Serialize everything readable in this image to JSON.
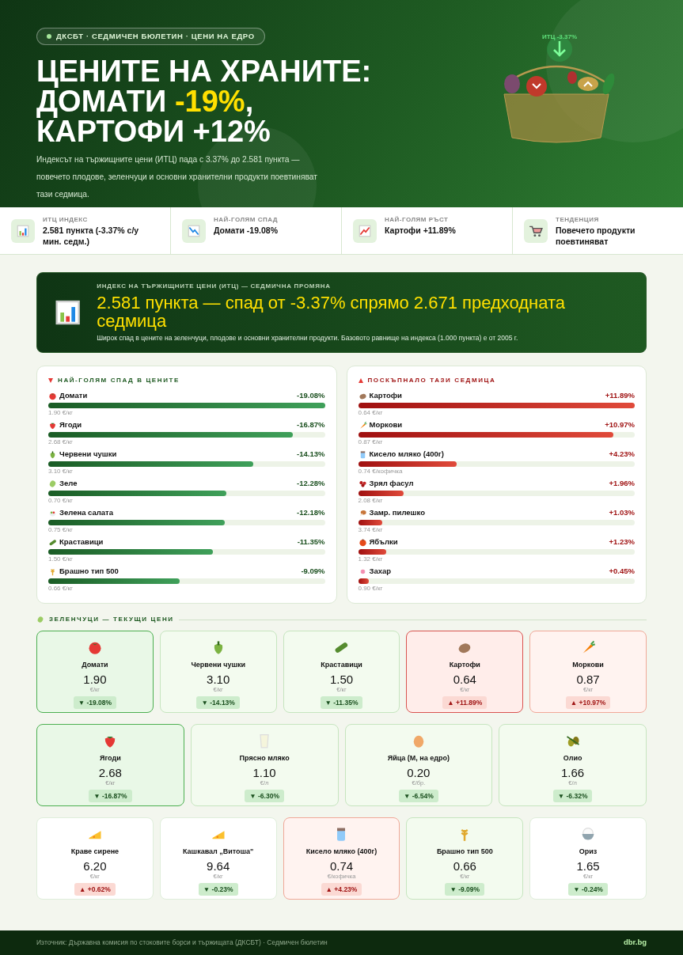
{
  "hero": {
    "tag": "ДКСБТ · СЕДМИЧЕН БЮЛЕТИН · ЦЕНИ НА ЕДРО",
    "title_lines": [
      "ЦЕНИТЕ НА ХРАНИТЕ:",
      "ДОМАТИ **-19%**,",
      "КАРТОФИ +12%"
    ],
    "lead": "Индексът на тържищните цени (ИТЦ) пада с 3.37% до 2.581 пункта — повечето плодове, зеленчуци и основни хранителни продукти поевтиняват тази седмица.",
    "badge_label": "ИТЦ -3.37%"
  },
  "stats": [
    {
      "kind": "chart",
      "label": "ИТЦ ИНДЕКС",
      "value": "2.581 пункта (-3.37% с/у мин. седм.)"
    },
    {
      "kind": "down",
      "label": "НАЙ-ГОЛЯМ СПАД",
      "value": "Домати -19.08%"
    },
    {
      "kind": "up",
      "label": "НАЙ-ГОЛЯМ РЪСТ",
      "value": "Картофи +11.89%"
    },
    {
      "kind": "cart",
      "label": "ТЕНДЕНЦИЯ",
      "value": "Повечето продукти поевтиняват"
    }
  ],
  "banner": {
    "kicker": "ИНДЕКС НА ТЪРЖИЩНИТЕ ЦЕНИ (ИТЦ) — СЕДМИЧНА ПРОМЯНА",
    "headline": "2.581 пункта — спад от -3.37% спрямо 2.671 предходната седмица",
    "note": "Широк спад в цените на зеленчуци, плодове и основни хранителни продукти. Базовото равнище на индекса (1.000 пункта) е от 2005 г."
  },
  "panels": [
    {
      "rising": false,
      "title": "НАЙ-ГОЛЯМ СПАД В ЦЕНИТЕ",
      "items": [
        {
          "kind": "tomato",
          "name": "Домати",
          "change": "-19.08%",
          "level": 1,
          "price": "1.90 €/кг"
        },
        {
          "kind": "strawberry",
          "name": "Ягоди",
          "change": "-16.87%",
          "level": 0.884,
          "price": "2.68 €/кг"
        },
        {
          "kind": "pepper",
          "name": "Червени чушки",
          "change": "-14.13%",
          "level": 0.741,
          "price": "3.10 €/кг"
        },
        {
          "kind": "cabbage",
          "name": "Зеле",
          "change": "-12.28%",
          "level": 0.644,
          "price": "0.70 €/кг"
        },
        {
          "kind": "salad",
          "name": "Зелена салата",
          "change": "-12.18%",
          "level": 0.638,
          "price": "0.75 €/кг"
        },
        {
          "kind": "cucumber",
          "name": "Краставици",
          "change": "-11.35%",
          "level": 0.595,
          "price": "1.50 €/кг"
        },
        {
          "kind": "wheat",
          "name": "Брашно тип 500",
          "change": "-9.09%",
          "level": 0.476,
          "price": "0.66 €/кг"
        }
      ]
    },
    {
      "rising": true,
      "title": "ПОСКЪПНАЛО ТАЗИ СЕДМИЦА",
      "items": [
        {
          "kind": "potato",
          "name": "Картофи",
          "change": "+11.89%",
          "level": 1,
          "price": "0.64 €/кг"
        },
        {
          "kind": "carrot",
          "name": "Моркови",
          "change": "+10.97%",
          "level": 0.922,
          "price": "0.87 €/кг"
        },
        {
          "kind": "jar",
          "name": "Кисело мляко (400г)",
          "change": "+4.23%",
          "level": 0.356,
          "price": "0.74 €/кофичка"
        },
        {
          "kind": "beans",
          "name": "Зрял фасул",
          "change": "+1.96%",
          "level": 0.165,
          "price": "2.08 €/кг"
        },
        {
          "kind": "chicken",
          "name": "Замр. пилешко",
          "change": "+1.03%",
          "level": 0.087,
          "price": "3.74 €/кг"
        },
        {
          "kind": "apple",
          "name": "Ябълки",
          "change": "+1.23%",
          "level": 0.103,
          "price": "1.32 €/кг"
        },
        {
          "kind": "candy",
          "name": "Захар",
          "change": "+0.45%",
          "level": 0.038,
          "price": "0.90 €/кг"
        }
      ]
    }
  ],
  "section": {
    "kind": "cabbage",
    "title": "ЗЕЛЕНЧУЦИ — ТЕКУЩИ ЦЕНИ"
  },
  "card_rows": [
    [
      {
        "kind": "tomato",
        "emphasized": true,
        "muted": false,
        "name": "Домати",
        "price": "1.90",
        "unit": "€/кг",
        "rising": false,
        "change": "▼ -19.08%"
      },
      {
        "kind": "pepper",
        "emphasized": false,
        "muted": false,
        "name": "Червени чушки",
        "price": "3.10",
        "unit": "€/кг",
        "rising": false,
        "change": "▼ -14.13%"
      },
      {
        "kind": "cucumber",
        "emphasized": false,
        "muted": false,
        "name": "Краставици",
        "price": "1.50",
        "unit": "€/кг",
        "rising": false,
        "change": "▼ -11.35%"
      },
      {
        "kind": "potato",
        "emphasized": true,
        "muted": false,
        "name": "Картофи",
        "price": "0.64",
        "unit": "€/кг",
        "rising": true,
        "change": "▲ +11.89%"
      },
      {
        "kind": "carrot",
        "emphasized": false,
        "muted": false,
        "name": "Моркови",
        "price": "0.87",
        "unit": "€/кг",
        "rising": true,
        "change": "▲ +10.97%"
      }
    ],
    [
      {
        "kind": "strawberry",
        "emphasized": true,
        "muted": false,
        "name": "Ягоди",
        "price": "2.68",
        "unit": "€/кг",
        "rising": false,
        "change": "▼ -16.87%"
      },
      {
        "kind": "milk",
        "emphasized": false,
        "muted": false,
        "name": "Прясно мляко",
        "price": "1.10",
        "unit": "€/л",
        "rising": false,
        "change": "▼ -6.30%"
      },
      {
        "kind": "egg",
        "emphasized": false,
        "muted": false,
        "name": "Яйца (М, на едро)",
        "price": "0.20",
        "unit": "€/бр.",
        "rising": false,
        "change": "▼ -6.54%"
      },
      {
        "kind": "olive",
        "emphasized": false,
        "muted": false,
        "name": "Олио",
        "price": "1.66",
        "unit": "€/л",
        "rising": false,
        "change": "▼ -6.32%"
      }
    ],
    [
      {
        "kind": "cheese",
        "emphasized": false,
        "muted": true,
        "name": "Краве сирене",
        "price": "6.20",
        "unit": "€/кг",
        "rising": true,
        "change": "▲ +0.62%"
      },
      {
        "kind": "cheese",
        "emphasized": false,
        "muted": true,
        "name": "Кашкавал „Витоша\"",
        "price": "9.64",
        "unit": "€/кг",
        "rising": false,
        "change": "▼ -0.23%"
      },
      {
        "kind": "jar",
        "emphasized": false,
        "muted": false,
        "name": "Кисело мляко (400г)",
        "price": "0.74",
        "unit": "€/кофичка",
        "rising": true,
        "change": "▲ +4.23%"
      },
      {
        "kind": "wheat",
        "emphasized": false,
        "muted": false,
        "name": "Брашно тип 500",
        "price": "0.66",
        "unit": "€/кг",
        "rising": false,
        "change": "▼ -9.09%"
      },
      {
        "kind": "rice",
        "emphasized": false,
        "muted": true,
        "name": "Ориз",
        "price": "1.65",
        "unit": "€/кг",
        "rising": false,
        "change": "▼ -0.24%"
      }
    ]
  ],
  "footer": {
    "source": "Източник: Държавна комисия по стоковите борси и тържищата (ДКСБТ) · Седмичен бюлетин",
    "site": "dbr.bg"
  }
}
